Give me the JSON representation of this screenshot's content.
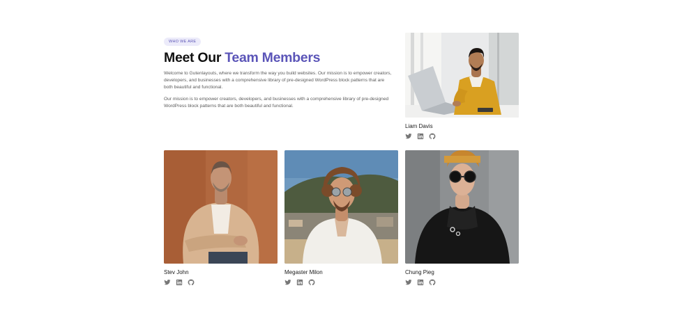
{
  "section": {
    "badge": "WHO WE ARE",
    "heading_plain": "Meet Our ",
    "heading_accent": "Team Members",
    "paragraphs": [
      "Welcome to Gutenlayouts, where we transform the way you build websites. Our mission is to empower creators, developers, and businesses with a comprehensive library of pre-designed WordPress block patterns that are both beautiful and functional.",
      "Our mission is to empower creators, developers, and businesses with a comprehensive library of pre-designed WordPress block patterns that are both beautiful and functional."
    ],
    "accent_color": "#5b55b8"
  },
  "members": [
    {
      "name": "Liam Davis",
      "photo_icon": "portrait-laptop-photo"
    },
    {
      "name": "Stev John",
      "photo_icon": "portrait-photo"
    },
    {
      "name": "Megaster Milon",
      "photo_icon": "portrait-photo"
    },
    {
      "name": "Chung Pieg",
      "photo_icon": "portrait-photo"
    }
  ],
  "social_icons": [
    "twitter-icon",
    "linkedin-icon",
    "github-icon"
  ]
}
